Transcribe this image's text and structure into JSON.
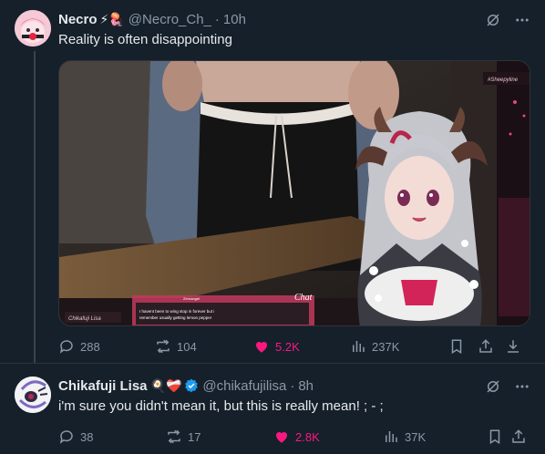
{
  "tweet1": {
    "display_name": "Necro",
    "emojis": "⚡🪼",
    "handle": "@Necro_Ch_",
    "separator": "·",
    "time": "10h",
    "text": "Reality is often disappointing",
    "media": {
      "overlay_tag": "#Sheepyline",
      "chat_title": "Chat",
      "chat_user": "Zeroangel",
      "chat_message_line1": "I havent been to wing stop in forever but i",
      "chat_message_line2": "remember usually getting lemon pepper",
      "nameplate": "Chikafuji Lisa"
    },
    "stats": {
      "replies": "288",
      "reposts": "104",
      "likes": "5.2K",
      "views": "237K"
    }
  },
  "tweet2": {
    "display_name": "Chikafuji Lisa",
    "emojis": "🍳❤️‍🩹",
    "handle": "@chikafujilisa",
    "separator": "·",
    "time": "8h",
    "text": "i'm sure you didn't mean it, but this is really mean! ; - ;",
    "stats": {
      "replies": "38",
      "reposts": "17",
      "likes": "2.8K",
      "views": "37K"
    }
  },
  "colors": {
    "background": "#15202b",
    "muted": "#8b98a5",
    "like": "#f91880",
    "verified": "#1d9bf0"
  }
}
